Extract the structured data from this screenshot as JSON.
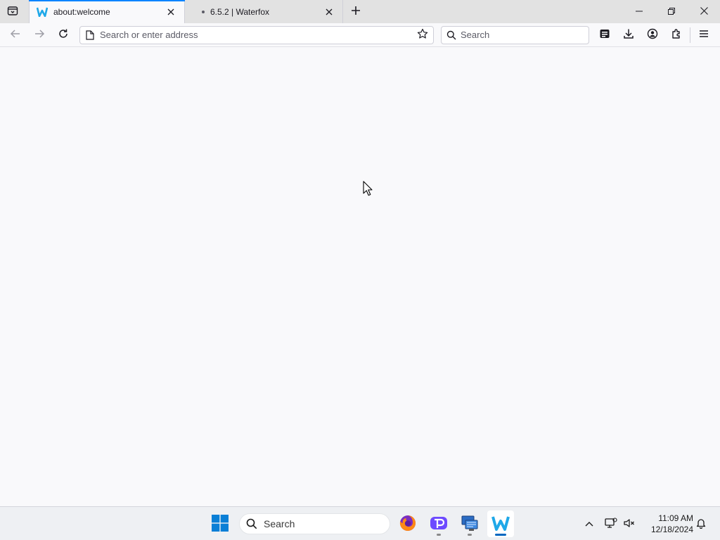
{
  "browser": {
    "tabs": [
      {
        "title": "about:welcome",
        "active": true
      },
      {
        "title": "6.5.2 | Waterfox",
        "active": false
      }
    ],
    "url_placeholder": "Search or enter address",
    "search_placeholder": "Search",
    "accent_color": "#0a84ff"
  },
  "icons": {
    "tab_manager": "tab-manager-icon",
    "new_tab": "plus-icon",
    "back": "back-arrow-icon",
    "forward": "forward-arrow-icon",
    "reload": "reload-icon",
    "page": "page-icon",
    "bookmark": "star-icon",
    "search": "search-icon",
    "reader": "reader-view-icon",
    "downloads": "download-icon",
    "account": "account-icon",
    "extensions": "extensions-icon",
    "menu": "hamburger-menu-icon"
  },
  "taskbar": {
    "search_label": "Search",
    "apps": [
      "Firefox",
      "Proton",
      "Remote Desktop",
      "Waterfox"
    ],
    "clock_time": "11:09 AM",
    "clock_date": "12/18/2024"
  }
}
